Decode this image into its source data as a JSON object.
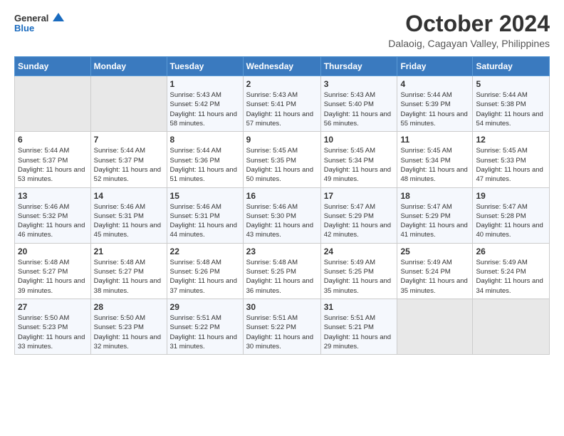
{
  "header": {
    "logo_line1": "General",
    "logo_line2": "Blue",
    "month_title": "October 2024",
    "subtitle": "Dalaoig, Cagayan Valley, Philippines"
  },
  "weekdays": [
    "Sunday",
    "Monday",
    "Tuesday",
    "Wednesday",
    "Thursday",
    "Friday",
    "Saturday"
  ],
  "weeks": [
    [
      {
        "day": "",
        "sunrise": "",
        "sunset": "",
        "daylight": ""
      },
      {
        "day": "",
        "sunrise": "",
        "sunset": "",
        "daylight": ""
      },
      {
        "day": "1",
        "sunrise": "Sunrise: 5:43 AM",
        "sunset": "Sunset: 5:42 PM",
        "daylight": "Daylight: 11 hours and 58 minutes."
      },
      {
        "day": "2",
        "sunrise": "Sunrise: 5:43 AM",
        "sunset": "Sunset: 5:41 PM",
        "daylight": "Daylight: 11 hours and 57 minutes."
      },
      {
        "day": "3",
        "sunrise": "Sunrise: 5:43 AM",
        "sunset": "Sunset: 5:40 PM",
        "daylight": "Daylight: 11 hours and 56 minutes."
      },
      {
        "day": "4",
        "sunrise": "Sunrise: 5:44 AM",
        "sunset": "Sunset: 5:39 PM",
        "daylight": "Daylight: 11 hours and 55 minutes."
      },
      {
        "day": "5",
        "sunrise": "Sunrise: 5:44 AM",
        "sunset": "Sunset: 5:38 PM",
        "daylight": "Daylight: 11 hours and 54 minutes."
      }
    ],
    [
      {
        "day": "6",
        "sunrise": "Sunrise: 5:44 AM",
        "sunset": "Sunset: 5:37 PM",
        "daylight": "Daylight: 11 hours and 53 minutes."
      },
      {
        "day": "7",
        "sunrise": "Sunrise: 5:44 AM",
        "sunset": "Sunset: 5:37 PM",
        "daylight": "Daylight: 11 hours and 52 minutes."
      },
      {
        "day": "8",
        "sunrise": "Sunrise: 5:44 AM",
        "sunset": "Sunset: 5:36 PM",
        "daylight": "Daylight: 11 hours and 51 minutes."
      },
      {
        "day": "9",
        "sunrise": "Sunrise: 5:45 AM",
        "sunset": "Sunset: 5:35 PM",
        "daylight": "Daylight: 11 hours and 50 minutes."
      },
      {
        "day": "10",
        "sunrise": "Sunrise: 5:45 AM",
        "sunset": "Sunset: 5:34 PM",
        "daylight": "Daylight: 11 hours and 49 minutes."
      },
      {
        "day": "11",
        "sunrise": "Sunrise: 5:45 AM",
        "sunset": "Sunset: 5:34 PM",
        "daylight": "Daylight: 11 hours and 48 minutes."
      },
      {
        "day": "12",
        "sunrise": "Sunrise: 5:45 AM",
        "sunset": "Sunset: 5:33 PM",
        "daylight": "Daylight: 11 hours and 47 minutes."
      }
    ],
    [
      {
        "day": "13",
        "sunrise": "Sunrise: 5:46 AM",
        "sunset": "Sunset: 5:32 PM",
        "daylight": "Daylight: 11 hours and 46 minutes."
      },
      {
        "day": "14",
        "sunrise": "Sunrise: 5:46 AM",
        "sunset": "Sunset: 5:31 PM",
        "daylight": "Daylight: 11 hours and 45 minutes."
      },
      {
        "day": "15",
        "sunrise": "Sunrise: 5:46 AM",
        "sunset": "Sunset: 5:31 PM",
        "daylight": "Daylight: 11 hours and 44 minutes."
      },
      {
        "day": "16",
        "sunrise": "Sunrise: 5:46 AM",
        "sunset": "Sunset: 5:30 PM",
        "daylight": "Daylight: 11 hours and 43 minutes."
      },
      {
        "day": "17",
        "sunrise": "Sunrise: 5:47 AM",
        "sunset": "Sunset: 5:29 PM",
        "daylight": "Daylight: 11 hours and 42 minutes."
      },
      {
        "day": "18",
        "sunrise": "Sunrise: 5:47 AM",
        "sunset": "Sunset: 5:29 PM",
        "daylight": "Daylight: 11 hours and 41 minutes."
      },
      {
        "day": "19",
        "sunrise": "Sunrise: 5:47 AM",
        "sunset": "Sunset: 5:28 PM",
        "daylight": "Daylight: 11 hours and 40 minutes."
      }
    ],
    [
      {
        "day": "20",
        "sunrise": "Sunrise: 5:48 AM",
        "sunset": "Sunset: 5:27 PM",
        "daylight": "Daylight: 11 hours and 39 minutes."
      },
      {
        "day": "21",
        "sunrise": "Sunrise: 5:48 AM",
        "sunset": "Sunset: 5:27 PM",
        "daylight": "Daylight: 11 hours and 38 minutes."
      },
      {
        "day": "22",
        "sunrise": "Sunrise: 5:48 AM",
        "sunset": "Sunset: 5:26 PM",
        "daylight": "Daylight: 11 hours and 37 minutes."
      },
      {
        "day": "23",
        "sunrise": "Sunrise: 5:48 AM",
        "sunset": "Sunset: 5:25 PM",
        "daylight": "Daylight: 11 hours and 36 minutes."
      },
      {
        "day": "24",
        "sunrise": "Sunrise: 5:49 AM",
        "sunset": "Sunset: 5:25 PM",
        "daylight": "Daylight: 11 hours and 35 minutes."
      },
      {
        "day": "25",
        "sunrise": "Sunrise: 5:49 AM",
        "sunset": "Sunset: 5:24 PM",
        "daylight": "Daylight: 11 hours and 35 minutes."
      },
      {
        "day": "26",
        "sunrise": "Sunrise: 5:49 AM",
        "sunset": "Sunset: 5:24 PM",
        "daylight": "Daylight: 11 hours and 34 minutes."
      }
    ],
    [
      {
        "day": "27",
        "sunrise": "Sunrise: 5:50 AM",
        "sunset": "Sunset: 5:23 PM",
        "daylight": "Daylight: 11 hours and 33 minutes."
      },
      {
        "day": "28",
        "sunrise": "Sunrise: 5:50 AM",
        "sunset": "Sunset: 5:23 PM",
        "daylight": "Daylight: 11 hours and 32 minutes."
      },
      {
        "day": "29",
        "sunrise": "Sunrise: 5:51 AM",
        "sunset": "Sunset: 5:22 PM",
        "daylight": "Daylight: 11 hours and 31 minutes."
      },
      {
        "day": "30",
        "sunrise": "Sunrise: 5:51 AM",
        "sunset": "Sunset: 5:22 PM",
        "daylight": "Daylight: 11 hours and 30 minutes."
      },
      {
        "day": "31",
        "sunrise": "Sunrise: 5:51 AM",
        "sunset": "Sunset: 5:21 PM",
        "daylight": "Daylight: 11 hours and 29 minutes."
      },
      {
        "day": "",
        "sunrise": "",
        "sunset": "",
        "daylight": ""
      },
      {
        "day": "",
        "sunrise": "",
        "sunset": "",
        "daylight": ""
      }
    ]
  ]
}
